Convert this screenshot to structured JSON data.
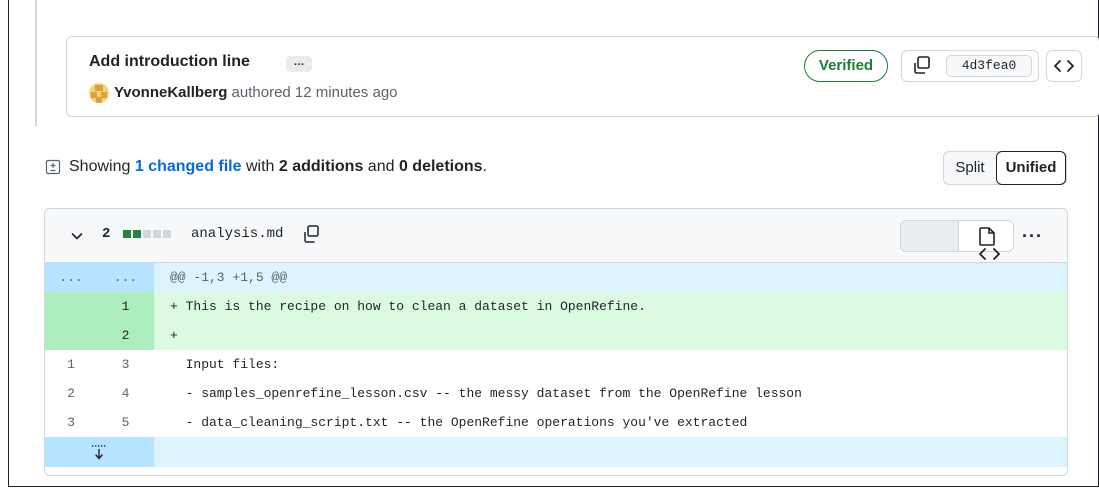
{
  "commit": {
    "title": "Add introduction line",
    "ellipsis": "…",
    "author": "YvonneKallberg",
    "authored_text": "authored 12 minutes ago",
    "verified_label": "Verified",
    "sha": "4d3fea0"
  },
  "summary": {
    "showing": "Showing",
    "changed_files": "1 changed file",
    "with": "with",
    "additions": "2 additions",
    "and": "and",
    "deletions": "0 deletions",
    "period": "."
  },
  "view_mode": {
    "split": "Split",
    "unified": "Unified",
    "selected": "Unified"
  },
  "file": {
    "change_count": "2",
    "filename": "analysis.md",
    "diffstat": {
      "added_blocks": 2,
      "neutral_blocks": 3
    },
    "more": "···"
  },
  "diff": {
    "hunk": {
      "left": "...",
      "right": "...",
      "header": "@@ -1,3 +1,5 @@"
    },
    "lines": [
      {
        "type": "add",
        "old": "",
        "new": "1",
        "text": "+ This is the recipe on how to clean a dataset in OpenRefine."
      },
      {
        "type": "add",
        "old": "",
        "new": "2",
        "text": "+ "
      },
      {
        "type": "ctx",
        "old": "1",
        "new": "3",
        "text": "  Input files:"
      },
      {
        "type": "ctx",
        "old": "2",
        "new": "4",
        "text": "  - samples_openrefine_lesson.csv -- the messy dataset from the OpenRefine lesson"
      },
      {
        "type": "ctx",
        "old": "3",
        "new": "5",
        "text": "  - data_cleaning_script.txt -- the OpenRefine operations you've extracted"
      }
    ]
  },
  "colors": {
    "accent": "#0969da",
    "verified": "#1a7f37",
    "add_bg": "#dafbe1",
    "add_num_bg": "#aceebb",
    "hunk_bg": "#ddf4ff",
    "hunk_num_bg": "#b6e3ff"
  }
}
